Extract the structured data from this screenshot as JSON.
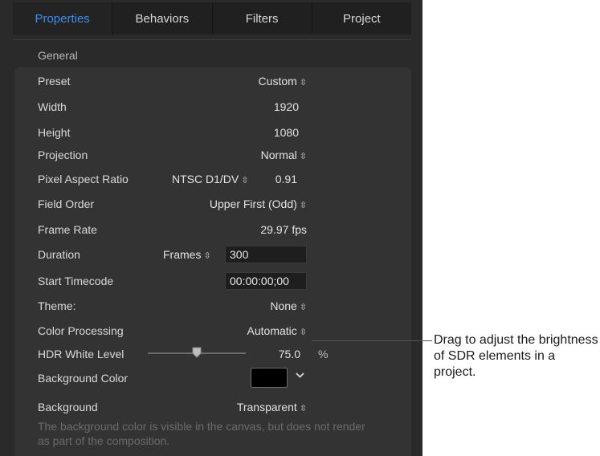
{
  "tabs": [
    {
      "label": "Properties",
      "active": true
    },
    {
      "label": "Behaviors"
    },
    {
      "label": "Filters"
    },
    {
      "label": "Project"
    }
  ],
  "section_header": "General",
  "rows": {
    "preset": {
      "label": "Preset",
      "value": "Custom"
    },
    "width": {
      "label": "Width",
      "value": "1920"
    },
    "height": {
      "label": "Height",
      "value": "1080"
    },
    "projection": {
      "label": "Projection",
      "value": "Normal"
    },
    "par": {
      "label": "Pixel Aspect Ratio",
      "preset": "NTSC D1/DV",
      "value": "0.91"
    },
    "field_order": {
      "label": "Field Order",
      "value": "Upper First (Odd)"
    },
    "frame_rate": {
      "label": "Frame Rate",
      "value": "29.97 fps"
    },
    "duration": {
      "label": "Duration",
      "unit": "Frames",
      "value": "300"
    },
    "start_tc": {
      "label": "Start Timecode",
      "value": "00:00:00;00"
    },
    "theme": {
      "label": "Theme:",
      "value": "None"
    },
    "color_processing": {
      "label": "Color Processing",
      "value": "Automatic"
    },
    "hdr": {
      "label": "HDR White Level",
      "value": "75.0",
      "unit": "%"
    },
    "bg_color": {
      "label": "Background Color",
      "color": "#000000"
    },
    "background": {
      "label": "Background",
      "value": "Transparent"
    }
  },
  "note": "The background color is visible in the canvas, but does not render as part of the composition.",
  "callout": "Drag to adjust the brightness of SDR elements in a project.",
  "icons": {
    "popup": "updown-chevron-icon",
    "swatch_menu": "chevron-down-icon",
    "slider_thumb": "slider-thumb-icon"
  },
  "colors": {
    "accent": "#3e8cf2",
    "panel": "#2a2a2a",
    "group": "#333333"
  }
}
